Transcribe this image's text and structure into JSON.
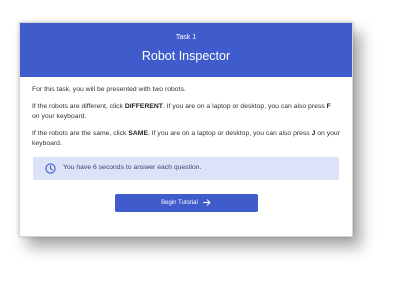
{
  "header": {
    "task_label": "Task 1",
    "title": "Robot Inspector",
    "color": "#3f5bcc"
  },
  "instructions": {
    "intro": "For this task, you will be presented with two robots.",
    "different": {
      "before": "If the robots are different, click ",
      "keyword": "DIFFERENT",
      "middle": ". If you are on a laptop or desktop, you can also press ",
      "key": "F",
      "after": " on your keyboard."
    },
    "same": {
      "before": "If the robots are the same, click ",
      "keyword": "SAME",
      "middle": ". If you are on a laptop or desktop, you can also press ",
      "key": "J",
      "after": " on your keyboard."
    }
  },
  "alert": {
    "icon": "clock-icon",
    "text": "You have 6 seconds to answer each question.",
    "background": "#dce2f7"
  },
  "button": {
    "label": "Begin Tutorial",
    "icon": "arrow-right-icon"
  }
}
